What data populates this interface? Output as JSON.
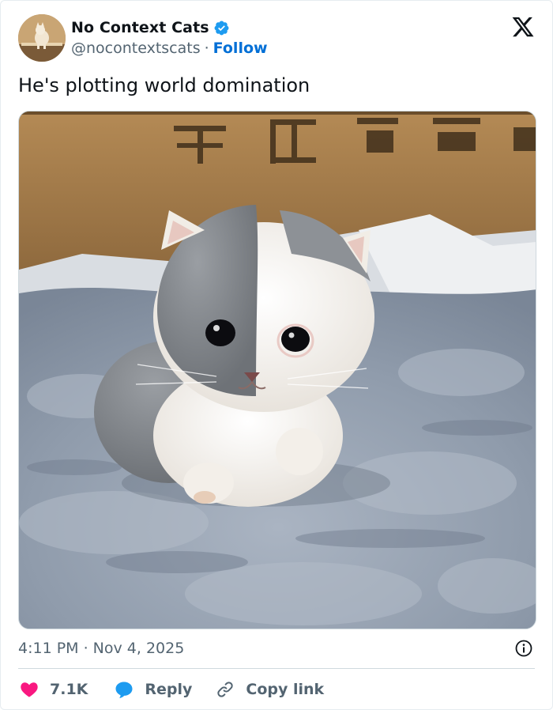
{
  "account": {
    "display_name": "No Context Cats",
    "handle": "@nocontextscats",
    "separator": "·",
    "follow_label": "Follow",
    "verified": true,
    "verified_icon": "verified-badge-icon",
    "brand_logo": "x-logo-icon"
  },
  "tweet": {
    "text": "He's plotting world domination",
    "timestamp": "4:11 PM · Nov 4, 2025",
    "media_description_icon": "photo"
  },
  "actions": {
    "like_count": "7.1K",
    "reply_label": "Reply",
    "copy_label": "Copy link",
    "info_icon": "info-icon"
  },
  "colors": {
    "text": "#0f1419",
    "secondary": "#536471",
    "link": "#006fd6",
    "verified": "#1d9bf0",
    "like": "#f91880",
    "reply": "#1d9bf0",
    "border": "#cfd9de"
  }
}
